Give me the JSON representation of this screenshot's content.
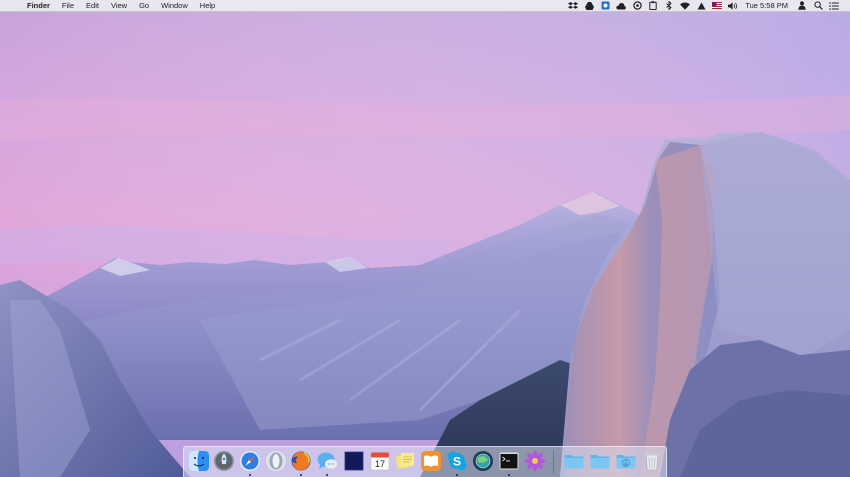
{
  "menubar": {
    "apple_symbol": "",
    "app_name": "Finder",
    "menus": [
      "File",
      "Edit",
      "View",
      "Go",
      "Window",
      "Help"
    ],
    "clock": "Tue 5:58 PM",
    "status_icons": [
      "dropbox-icon",
      "google-drive-icon",
      "mendeley-icon",
      "creative-cloud-icon",
      "circle-icon",
      "clipboard-icon",
      "bluetooth-icon",
      "wifi-icon",
      "input-method-icon",
      "us-flag-icon",
      "volume-icon",
      "user-icon",
      "spotlight-icon",
      "notification-center-icon"
    ]
  },
  "dock": {
    "apps": [
      {
        "name": "finder-icon",
        "running": true
      },
      {
        "name": "launchpad-icon",
        "running": false
      },
      {
        "name": "safari-icon",
        "running": true
      },
      {
        "name": "opera-icon",
        "running": false
      },
      {
        "name": "firefox-icon",
        "running": true
      },
      {
        "name": "messages-icon",
        "running": true
      },
      {
        "name": "dark-square-app-icon",
        "running": false
      },
      {
        "name": "calendar-icon",
        "running": false
      },
      {
        "name": "stickies-icon",
        "running": false
      },
      {
        "name": "ibooks-icon",
        "running": false
      },
      {
        "name": "skype-icon",
        "running": true
      },
      {
        "name": "globe-app-icon",
        "running": false
      },
      {
        "name": "terminal-icon",
        "running": true
      },
      {
        "name": "purple-flower-icon",
        "running": false
      }
    ],
    "stacks": [
      "folder-icon",
      "folder-icon",
      "downloads-folder-icon",
      "trash-icon"
    ]
  }
}
